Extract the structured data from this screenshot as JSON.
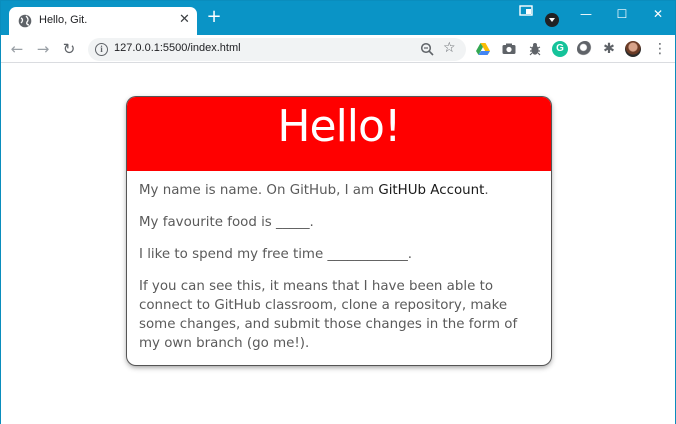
{
  "browser": {
    "tab_title": "Hello, Git.",
    "tab_close": "✕",
    "new_tab": "+",
    "window_buttons": {
      "minimize": "—",
      "maximize": "☐",
      "close": "✕"
    },
    "address": "127.0.0.1:5500/index.html",
    "nav": {
      "back": "←",
      "forward": "→",
      "reload": "↻"
    },
    "star": "☆",
    "extensions": {
      "grammarly": "G",
      "puzzle": "✱",
      "menu": "⋮"
    }
  },
  "page": {
    "heading": "Hello!",
    "line1_prefix": "My name is name. On GitHub, I am ",
    "line1_account": "GitHUb Account",
    "line1_suffix": ".",
    "line2": "My favourite food is _____.",
    "line3": "I like to spend my free time ____________.",
    "line4": "If you can see this, it means that I have been able to connect to GitHub classroom, clone a repository, make some changes, and submit those changes in the form of my own branch (go me!)."
  },
  "colors": {
    "titlebar": "#0a94c6",
    "header_red": "#ff0000"
  }
}
